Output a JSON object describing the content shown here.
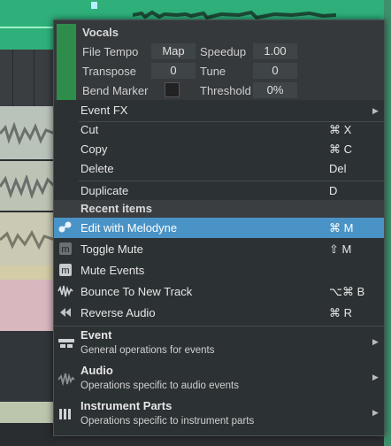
{
  "props": {
    "title": "Vocals",
    "file_tempo_label": "File Tempo",
    "file_tempo_value": "Map",
    "speedup_label": "Speedup",
    "speedup_value": "1.00",
    "transpose_label": "Transpose",
    "transpose_value": "0",
    "tune_label": "Tune",
    "tune_value": "0",
    "bend_marker_label": "Bend Marker",
    "threshold_label": "Threshold",
    "threshold_value": "0%"
  },
  "menu": {
    "event_fx": "Event FX",
    "cut": "Cut",
    "cut_shortcut": "⌘ X",
    "copy": "Copy",
    "copy_shortcut": "⌘ C",
    "delete": "Delete",
    "delete_shortcut": "Del",
    "duplicate": "Duplicate",
    "duplicate_shortcut": "D",
    "recent_header": "Recent items",
    "edit_melodyne": "Edit with Melodyne",
    "edit_melodyne_shortcut": "⌘ M",
    "toggle_mute": "Toggle Mute",
    "toggle_mute_shortcut": "⇧ M",
    "mute_events": "Mute Events",
    "bounce": "Bounce To New Track",
    "bounce_shortcut": "⌥⌘ B",
    "reverse": "Reverse Audio",
    "reverse_shortcut": "⌘ R",
    "submenus": [
      {
        "label": "Event",
        "desc": "General operations for events"
      },
      {
        "label": "Audio",
        "desc": "Operations specific to audio events"
      },
      {
        "label": "Instrument Parts",
        "desc": "Operations specific to instrument parts"
      }
    ]
  },
  "colors": {
    "highlight": "#4a93c6",
    "event_green": "#2e8d4a",
    "track_green": "#2fb07b"
  }
}
